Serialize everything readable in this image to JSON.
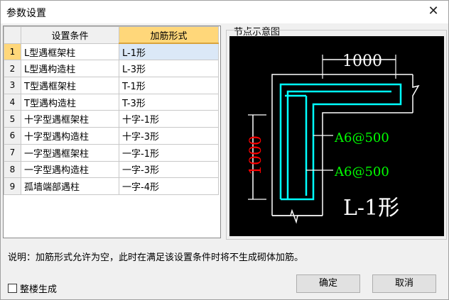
{
  "window": {
    "title": "参数设置"
  },
  "grid": {
    "headers": {
      "condition": "设置条件",
      "form": "加筋形式"
    },
    "rows": [
      {
        "num": "1",
        "condition": "L型遇框架柱",
        "form": "L-1形"
      },
      {
        "num": "2",
        "condition": "L型遇构造柱",
        "form": "L-3形"
      },
      {
        "num": "3",
        "condition": "T型遇框架柱",
        "form": "T-1形"
      },
      {
        "num": "4",
        "condition": "T型遇构造柱",
        "form": "T-3形"
      },
      {
        "num": "5",
        "condition": "十字型遇框架柱",
        "form": "十字-1形"
      },
      {
        "num": "6",
        "condition": "十字型遇构造柱",
        "form": "十字-3形"
      },
      {
        "num": "7",
        "condition": "一字型遇框架柱",
        "form": "一字-1形"
      },
      {
        "num": "8",
        "condition": "一字型遇构造柱",
        "form": "一字-3形"
      },
      {
        "num": "9",
        "condition": "孤墙端部遇柱",
        "form": "一字-4形"
      }
    ],
    "selected_row": 1
  },
  "diagram": {
    "group_label": "节点示意图",
    "dim_horizontal": "1000",
    "dim_vertical": "1000",
    "rebar_label_1": "A6@500",
    "rebar_label_2": "A6@500",
    "shape_label": "L-1形",
    "colors": {
      "background": "#000000",
      "wall": "#ffffff",
      "rebar": "#00ffff",
      "dimension_h": "#ffffff",
      "dimension_v": "#ff0000",
      "rebar_text": "#00ff00",
      "shape_text": "#ffffff"
    }
  },
  "note": "说明：加筋形式允许为空，此时在满足该设置条件时将不生成砌体加筋。",
  "options": {
    "whole_building_label": "整楼生成",
    "whole_building_checked": false
  },
  "buttons": {
    "ok": "确定",
    "cancel": "取消"
  }
}
